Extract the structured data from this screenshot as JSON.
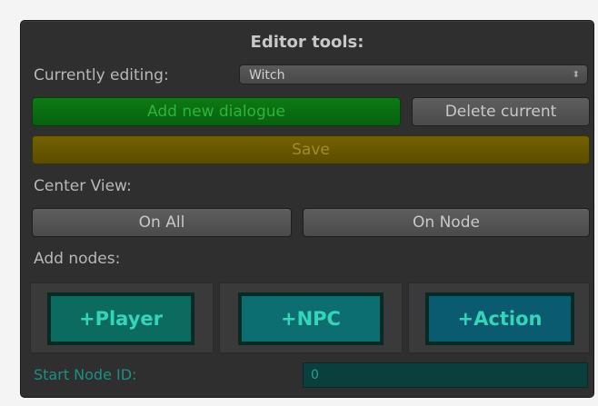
{
  "editor": {
    "title": "Editor tools:",
    "currently_editing_label": "Currently editing:",
    "currently_editing_value": "Witch",
    "select_arrow": "⬍",
    "add_dialogue_label": "Add new dialogue",
    "delete_current_label": "Delete current",
    "save_label": "Save",
    "center_view_label": "Center View:",
    "on_all_label": "On All",
    "on_node_label": "On Node",
    "add_nodes_label": "Add nodes:",
    "add_player_label": "+Player",
    "add_npc_label": "+NPC",
    "add_action_label": "+Action",
    "start_node_label": "Start Node ID:",
    "start_node_value": "0"
  },
  "colors": {
    "panel_bg": "#2f2f2f",
    "green_button": "#0d7a14",
    "yellow_button": "#736100",
    "teal_accent": "#36d4b8",
    "start_field_bg": "#0b3f3d"
  }
}
